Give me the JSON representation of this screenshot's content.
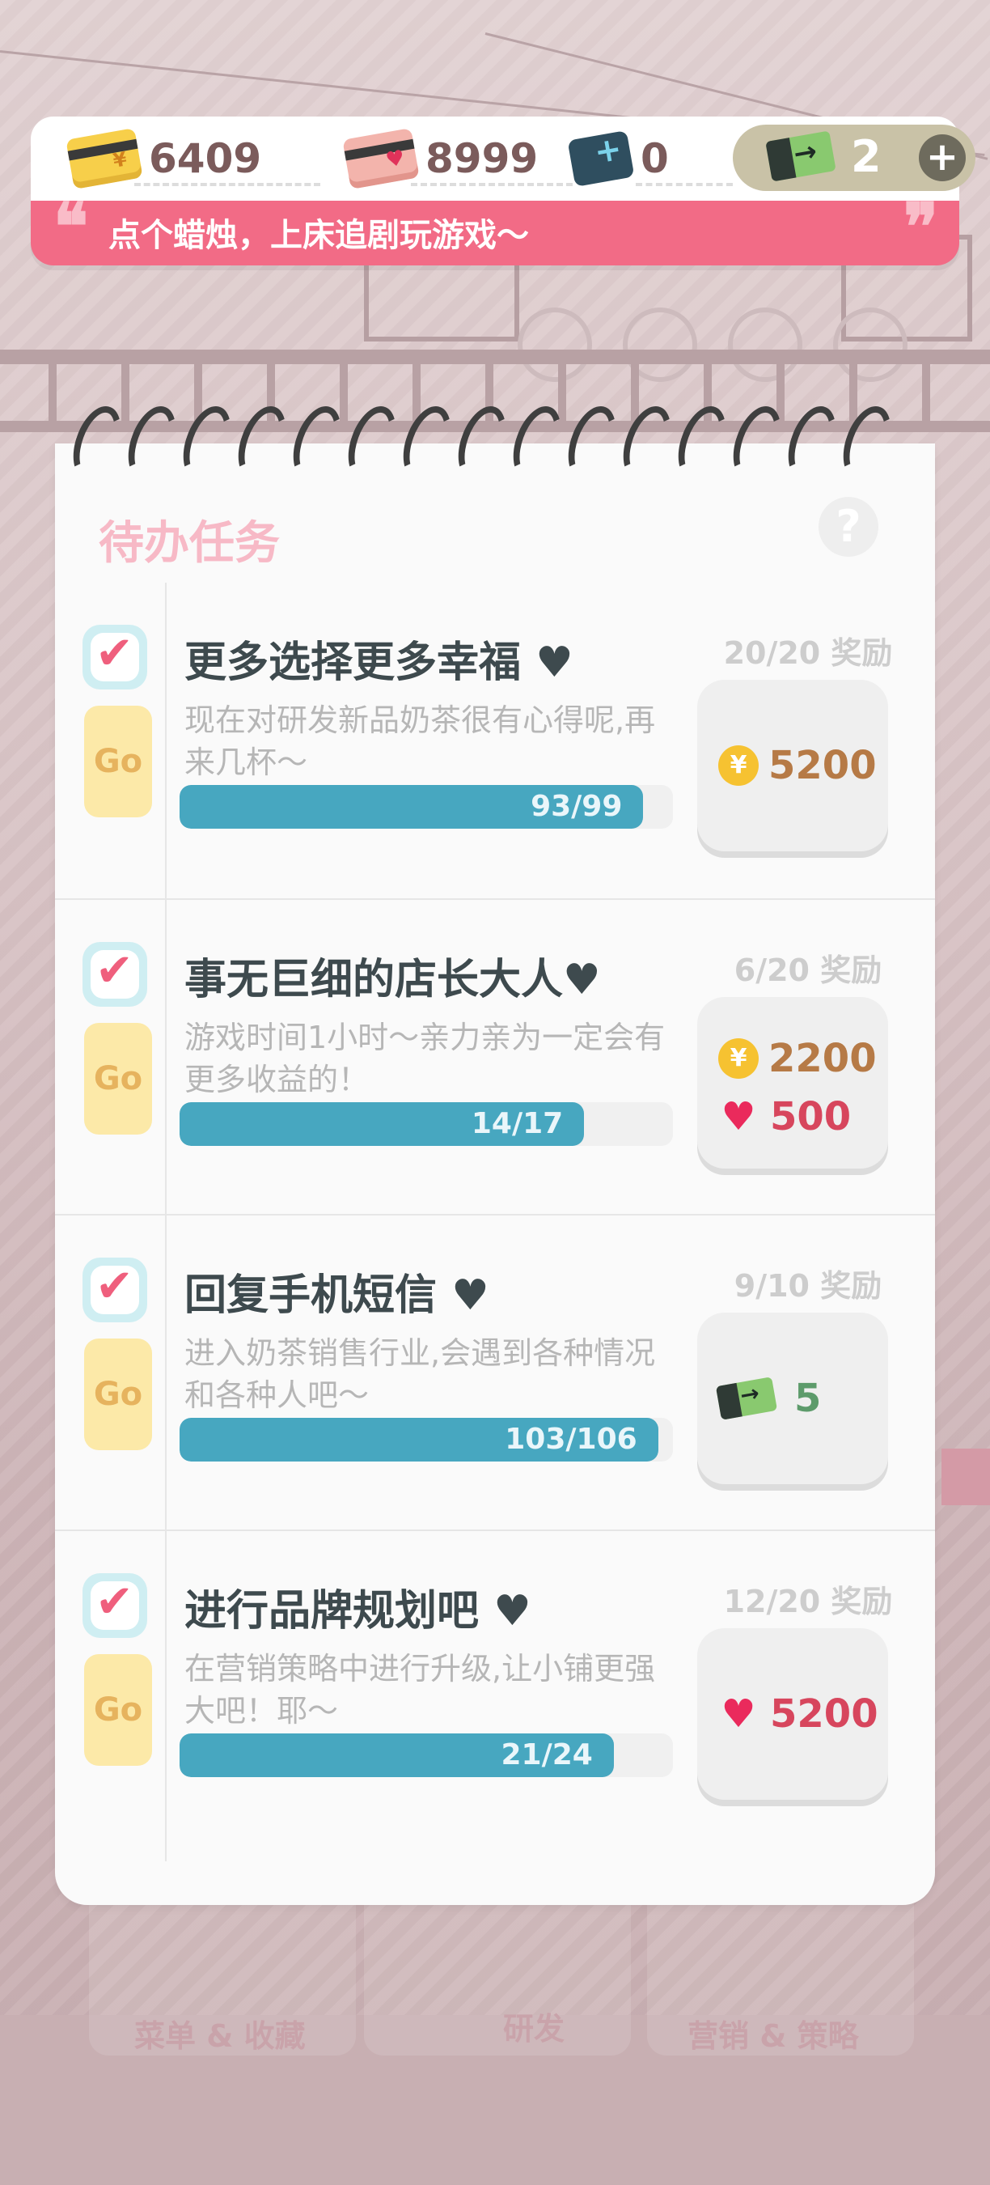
{
  "currency": {
    "gold_card": "6409",
    "heart_card": "8999",
    "blue_card": "0",
    "ticket": "2",
    "plus_symbol": "+"
  },
  "banner": {
    "message": "点个蜡烛，上床追剧玩游戏～",
    "open_quote": "❝",
    "close_quote": "❞"
  },
  "notebook": {
    "title": "待办任务",
    "help_symbol": "?"
  },
  "background_tabs": [
    "菜单 & 收藏",
    "研发",
    "营销 & 策略"
  ],
  "tasks": [
    {
      "title": "更多选择更多幸福 ♥",
      "desc": "现在对研发新品奶茶很有心得呢,再来几杯～",
      "progress_text": "93/99",
      "progress": 0.94,
      "reward_label": "20/20 奖励",
      "go": "Go",
      "checked": true,
      "rewards": [
        {
          "type": "coin-icon",
          "amount": "5200"
        }
      ]
    },
    {
      "title": "事无巨细的店长大人♥",
      "desc": "游戏时间1小时～亲力亲为一定会有更多收益的！",
      "progress_text": "14/17",
      "progress": 0.82,
      "reward_label": "6/20 奖励",
      "go": "Go",
      "checked": true,
      "rewards": [
        {
          "type": "coin-icon",
          "amount": "2200"
        },
        {
          "type": "heart-icon",
          "amount": "500"
        }
      ]
    },
    {
      "title": "回复手机短信 ♥",
      "desc": "进入奶茶销售行业,会遇到各种情况和各种人吧～",
      "progress_text": "103/106",
      "progress": 0.97,
      "reward_label": "9/10 奖励",
      "go": "Go",
      "checked": true,
      "rewards": [
        {
          "type": "ticket-icon",
          "amount": "5"
        }
      ]
    },
    {
      "title": "进行品牌规划吧 ♥",
      "desc": "在营销策略中进行升级,让小铺更强大吧！耶～",
      "progress_text": "21/24",
      "progress": 0.88,
      "reward_label": "12/20 奖励",
      "go": "Go",
      "checked": true,
      "rewards": [
        {
          "type": "heart-icon",
          "amount": "5200"
        }
      ]
    }
  ],
  "colors": {
    "accent_pink": "#f26b86",
    "progress_blue": "#47a7c0",
    "title_pink": "#f7b9c6",
    "go_yellow": "#fce9a8"
  }
}
